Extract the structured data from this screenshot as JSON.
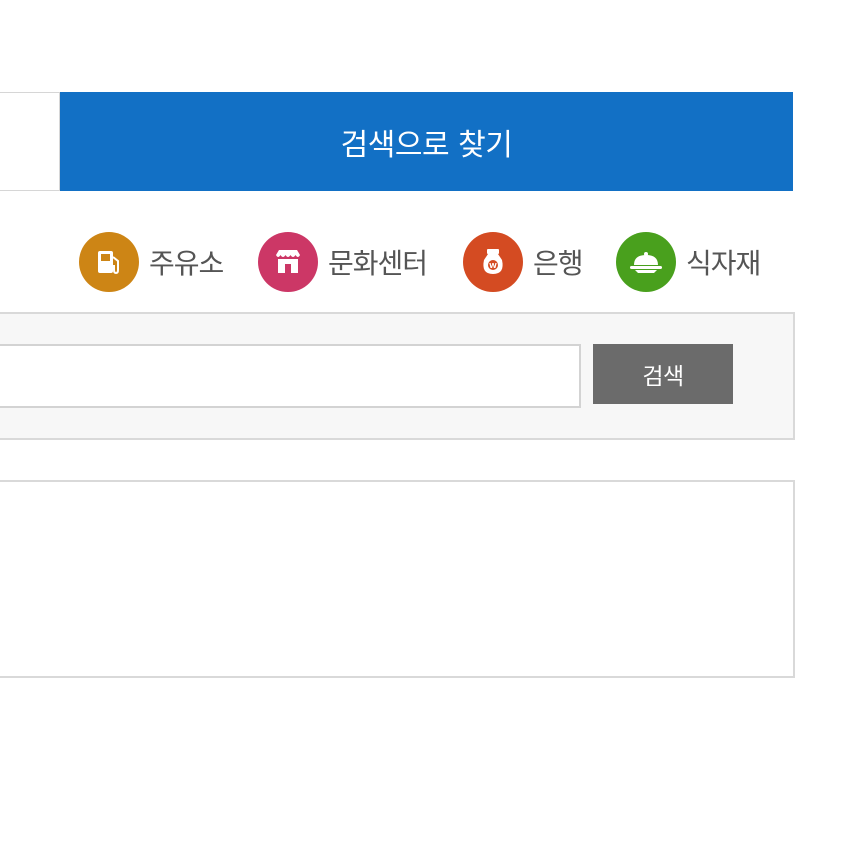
{
  "tabs": {
    "search_tab_label": "검색으로 찾기"
  },
  "categories": [
    {
      "label": "주유소",
      "icon": "gas-pump-icon",
      "color": "#cd8515"
    },
    {
      "label": "문화센터",
      "icon": "store-icon",
      "color": "#cc3766"
    },
    {
      "label": "은행",
      "icon": "money-bag-icon",
      "color": "#d44b22"
    },
    {
      "label": "식자재",
      "icon": "food-dish-icon",
      "color": "#49a01d"
    }
  ],
  "search": {
    "input_value": "",
    "placeholder": "",
    "button_label": "검색"
  },
  "colors": {
    "accent": "#1270c5",
    "search_button": "#6b6b6b"
  }
}
